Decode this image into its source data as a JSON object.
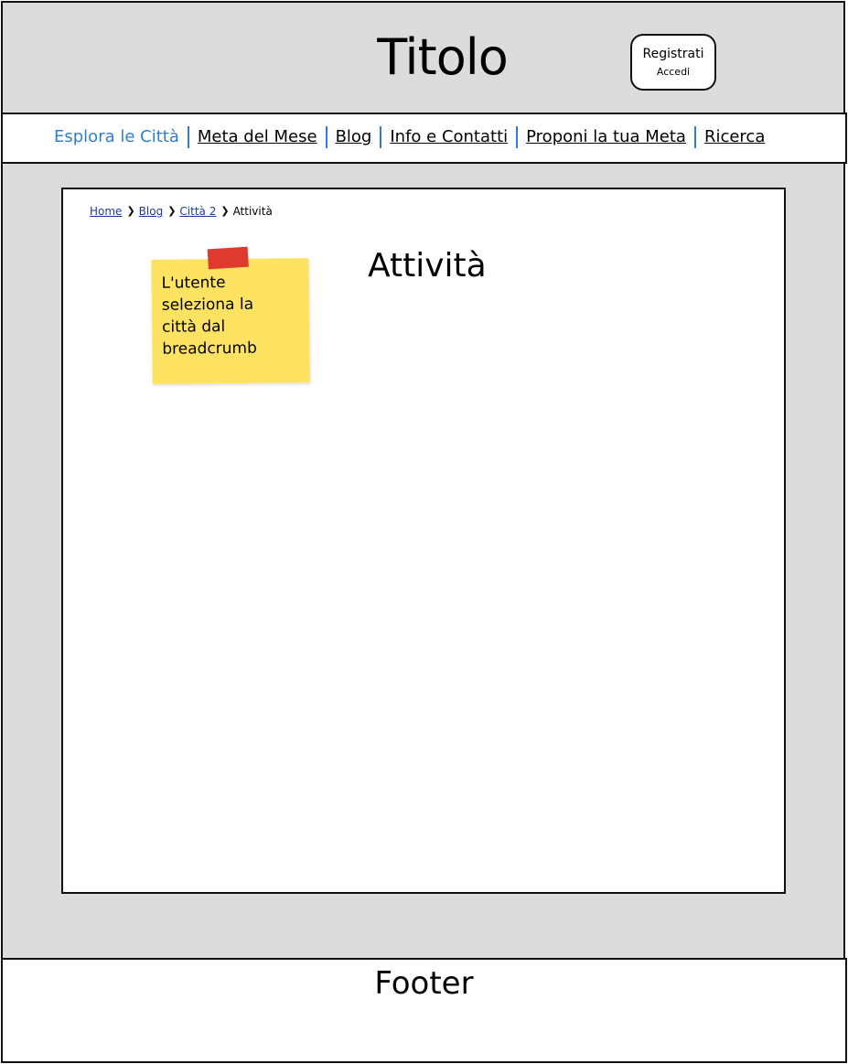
{
  "header": {
    "title": "Titolo",
    "register_label": "Registrati",
    "login_label": "Accedi"
  },
  "nav": {
    "items": [
      {
        "label": "Esplora le Città",
        "active": true
      },
      {
        "label": "Meta del Mese",
        "active": false
      },
      {
        "label": "Blog",
        "active": false
      },
      {
        "label": "Info e Contatti",
        "active": false
      },
      {
        "label": "Proponi la tua Meta",
        "active": false
      },
      {
        "label": "Ricerca",
        "active": false
      }
    ]
  },
  "breadcrumb": {
    "items": [
      "Home",
      "Blog",
      "Città 2"
    ],
    "current": "Attività",
    "separator_icon": "chevron-right-icon"
  },
  "main": {
    "heading": "Attività",
    "sticky_note": "L'utente\nseleziona la\ncittà dal\nbreadcrumb"
  },
  "footer": {
    "text": "Footer"
  },
  "colors": {
    "background_gray": "#dcdcdc",
    "nav_accent": "#2f7fd0",
    "link_blue": "#1a3f9a",
    "sticky_yellow": "#fde361",
    "sticky_tape": "#e03a2f"
  }
}
